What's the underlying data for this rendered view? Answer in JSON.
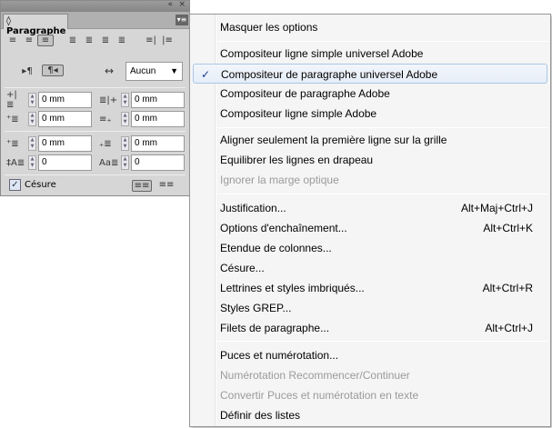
{
  "panel": {
    "title": "Paragraphe",
    "collapse_icon": "«",
    "close_icon": "×",
    "menu_icon": "▾≡",
    "composer_select": "Aucun",
    "fields": {
      "left_indent": "0 mm",
      "right_indent": "0 mm",
      "first_line_indent": "0 mm",
      "last_line_indent": "0 mm",
      "space_before": "0 mm",
      "space_after": "0 mm",
      "drop_cap_lines": "0",
      "drop_cap_chars": "0"
    },
    "hyphenate_label": "Césure",
    "hyphenate_checked": true
  },
  "menu": {
    "items": [
      {
        "label": "Masquer les options",
        "shortcut": "",
        "disabled": false
      },
      {
        "label": "Compositeur ligne simple universel Adobe",
        "shortcut": "",
        "disabled": false
      },
      {
        "label": "Compositeur de paragraphe universel Adobe",
        "shortcut": "",
        "disabled": false,
        "checked": true
      },
      {
        "label": "Compositeur de paragraphe Adobe",
        "shortcut": "",
        "disabled": false
      },
      {
        "label": "Compositeur ligne simple Adobe",
        "shortcut": "",
        "disabled": false
      },
      {
        "label": "Aligner seulement la première ligne sur la grille",
        "shortcut": "",
        "disabled": false
      },
      {
        "label": "Equilibrer les lignes en drapeau",
        "shortcut": "",
        "disabled": false
      },
      {
        "label": "Ignorer la marge optique",
        "shortcut": "",
        "disabled": true
      },
      {
        "label": "Justification...",
        "shortcut": "Alt+Maj+Ctrl+J",
        "disabled": false
      },
      {
        "label": "Options d'enchaînement...",
        "shortcut": "Alt+Ctrl+K",
        "disabled": false
      },
      {
        "label": "Etendue de colonnes...",
        "shortcut": "",
        "disabled": false
      },
      {
        "label": "Césure...",
        "shortcut": "",
        "disabled": false
      },
      {
        "label": "Lettrines et styles imbriqués...",
        "shortcut": "Alt+Ctrl+R",
        "disabled": false
      },
      {
        "label": "Styles GREP...",
        "shortcut": "",
        "disabled": false
      },
      {
        "label": "Filets de paragraphe...",
        "shortcut": "Alt+Ctrl+J",
        "disabled": false
      },
      {
        "label": "Puces et numérotation...",
        "shortcut": "",
        "disabled": false
      },
      {
        "label": "Numérotation Recommencer/Continuer",
        "shortcut": "",
        "disabled": true
      },
      {
        "label": "Convertir Puces et numérotation en texte",
        "shortcut": "",
        "disabled": true
      },
      {
        "label": "Définir des listes",
        "shortcut": "",
        "disabled": false
      }
    ],
    "check_mark": "✓"
  }
}
